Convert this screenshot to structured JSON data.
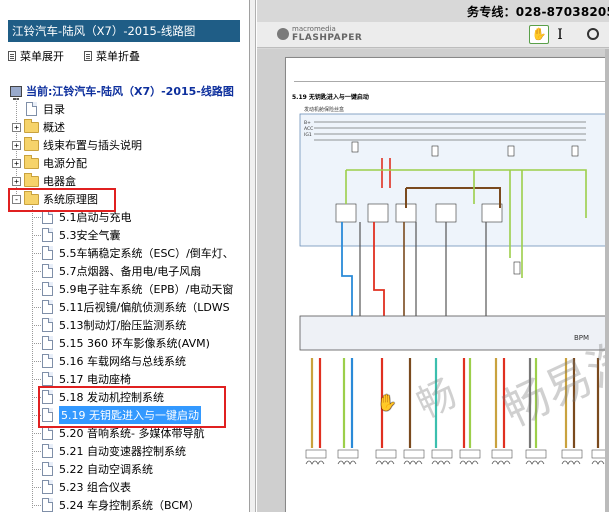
{
  "left_pane": {
    "title": "江铃汽车-陆风（X7）-2015-线路图",
    "menu": {
      "expand_label": "菜单展开",
      "collapse_label": "菜单折叠"
    },
    "tree": {
      "root_label": "当前:江铃汽车-陆风（X7）-2015-线路图",
      "folders": [
        {
          "label": "目录",
          "type": "page",
          "expander": ""
        },
        {
          "label": "概述",
          "type": "folder",
          "expander": "+"
        },
        {
          "label": "线束布置与插头说明",
          "type": "folder",
          "expander": "+"
        },
        {
          "label": "电源分配",
          "type": "folder",
          "expander": "+"
        },
        {
          "label": "电器盒",
          "type": "folder",
          "expander": "+"
        },
        {
          "label": "系统原理图",
          "type": "folder",
          "expander": "-"
        }
      ],
      "children": [
        "5.1启动与充电",
        "5.3安全气囊",
        "5.5车辆稳定系统（ESC）/倒车灯、",
        "5.7点烟器、备用电/电子风扇",
        "5.9电子驻车系统（EPB）/电动天窗",
        "5.11后视镜/偏航侦测系统（LDWS",
        "5.13制动灯/胎压监测系统",
        "5.15 360 环车影像系统(AVM)",
        "5.16 车载网络与总线系统",
        "5.17 电动座椅",
        "5.18 发动机控制系统",
        "5.19 无钥匙进入与一键启动",
        "5.20 音响系统- 多媒体带导航",
        "5.21 自动变速器控制系统",
        "5.22 自动空调系统",
        "5.23 组合仪表",
        "5.24 车身控制系统（BCM）"
      ],
      "selected_index": 11
    }
  },
  "right_pane": {
    "hotline": "务专线：028-87038205",
    "toolbar": {
      "brand_small": "macromedia",
      "brand_big": "FLASHPAPER",
      "hand_icon": "hand-icon",
      "text_icon": "text-select-icon",
      "text_glyph": "I"
    },
    "page": {
      "page_number": "5.",
      "section_title": "5.19 无钥匙进入与一键启动",
      "module_label": "BPM",
      "relay_label": "发动机舱保险丝盒",
      "fuse_labels": [
        "B+",
        "ACC",
        "IG1"
      ],
      "watermark_1": "畅",
      "watermark_2": "畅易汽车"
    }
  },
  "colors": {
    "title_bar": "#1f5d86",
    "selection": "#3399ff",
    "highlight_box": "#e02020",
    "wire_red": "#e03020",
    "wire_green": "#9ccf4a",
    "wire_brown": "#7a4a1e",
    "wire_blue": "#2a8ad8"
  }
}
